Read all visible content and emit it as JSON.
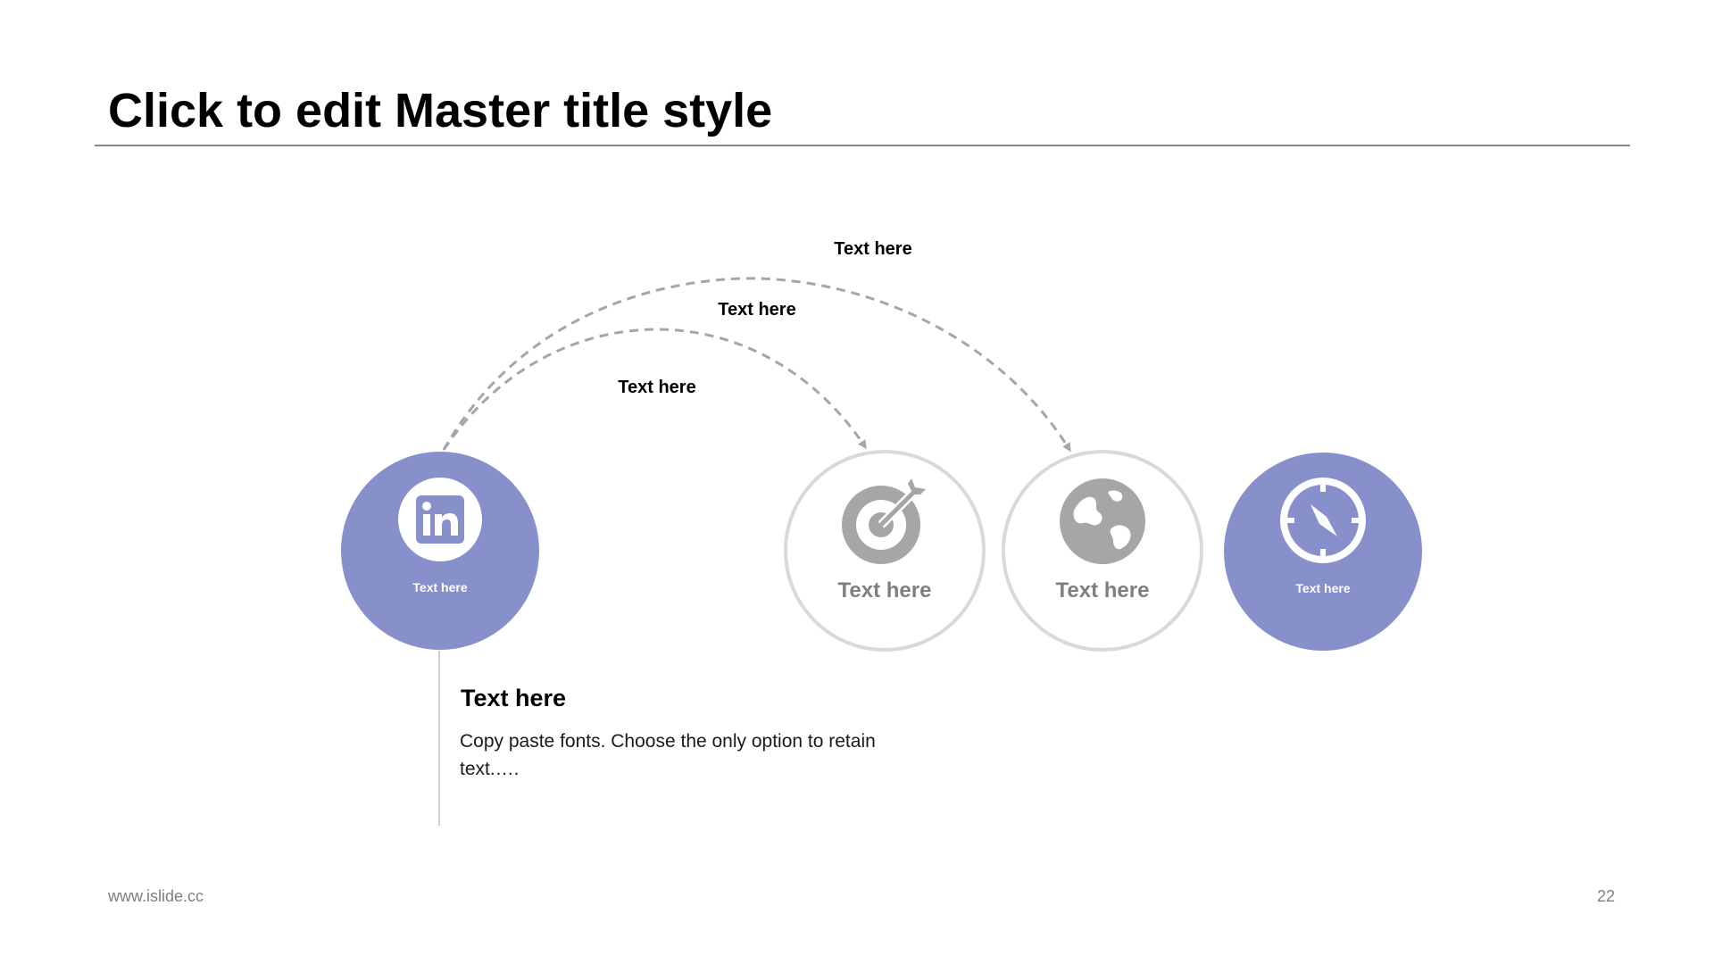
{
  "slide": {
    "title": "Click to edit Master title style",
    "footer_url": "www.islide.cc",
    "page_number": "22"
  },
  "colors": {
    "accent": "#8890cc",
    "outline_gray": "#d9d9d9",
    "icon_gray": "#a6a6a6",
    "arrow_gray": "#a6a6a6",
    "rule_gray": "#8a8a8a"
  },
  "arcs": [
    {
      "label": "Text here",
      "from": "node-1",
      "to": "node-3"
    },
    {
      "label": "Text here",
      "from": "node-1",
      "to": "node-3"
    },
    {
      "label": "Text here",
      "from": "node-1",
      "to": "node-2"
    }
  ],
  "nodes": [
    {
      "label": "Text here",
      "icon": "linkedin-icon",
      "style": "filled"
    },
    {
      "label": "Text here",
      "icon": "target-icon",
      "style": "outline"
    },
    {
      "label": "Text here",
      "icon": "globe-icon",
      "style": "outline"
    },
    {
      "label": "Text here",
      "icon": "compass-icon",
      "style": "filled"
    }
  ],
  "detail": {
    "heading": "Text here",
    "body": "Copy paste fonts. Choose the only option to retain text.…."
  }
}
